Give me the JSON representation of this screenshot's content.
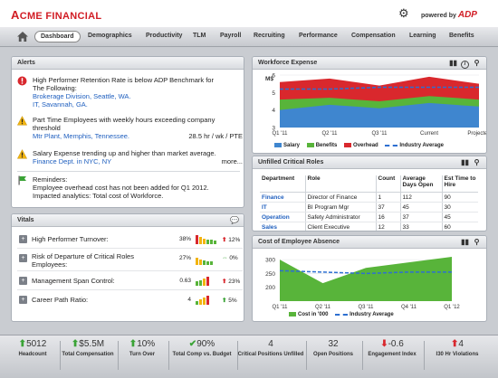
{
  "header": {
    "logo_lead": "A",
    "logo_rest": "CME FINANCIAL",
    "powered_by": "powered by",
    "powered_brand": "ADP"
  },
  "nav": {
    "tabs": [
      "Dashboard",
      "Demographics",
      "Productivity",
      "TLM",
      "Payroll",
      "Recruiting",
      "Performance",
      "Compensation",
      "Learning",
      "Benefits"
    ],
    "active": "Dashboard"
  },
  "alerts": {
    "title": "Alerts",
    "items": [
      {
        "icon": "error",
        "line1": "High Performer Retention Rate is below ADP Benchmark for",
        "line2": "The Following:",
        "link1": "Brokerage Division, Seattle, WA.",
        "link2": "IT, Savannah, GA."
      },
      {
        "icon": "warning",
        "line1": "Part Time Employees with weekly hours exceeding company",
        "line2": "threshold",
        "link1": "Mtr Plant, Memphis, Tennessee.",
        "value": "28.5 hr / wk / PTE"
      },
      {
        "icon": "warning",
        "line1": "Salary Expense trending up and higher than market average.",
        "link1": "Finance Dept. in NYC, NY",
        "more": "more..."
      },
      {
        "icon": "flag",
        "line1": "Reminders:",
        "line2": "Employee overhead cost has not been added for Q1 2012.",
        "line3": "Impacted analytics: Total cost of Workforce."
      }
    ]
  },
  "vitals": {
    "title": "Vitals",
    "rows": [
      {
        "label": "High Performer Turnover:",
        "value": "38%",
        "trend": "up",
        "change": "12%"
      },
      {
        "label": "Risk of Departure of Critical Roles Employees:",
        "value": "27%",
        "trend": "flat",
        "change": "0%"
      },
      {
        "label": "Management Span Control:",
        "value": "0.63",
        "trend": "up",
        "change": "23%"
      },
      {
        "label": "Career Path Ratio:",
        "value": "4",
        "trend": "up",
        "change": "5%"
      }
    ]
  },
  "workforce_expense": {
    "title": "Workforce Expense",
    "unit_label": "M$",
    "legend": [
      "Salary",
      "Benefits",
      "Overhead",
      "Industry Average"
    ]
  },
  "critical_roles": {
    "title": "Unfilled Critical Roles",
    "columns": [
      "Department",
      "Role",
      "Count",
      "Average Days Open",
      "Est Time to Hire"
    ],
    "rows": [
      [
        "Finance",
        "Director of Finance",
        "1",
        "112",
        "90"
      ],
      [
        "IT",
        "BI Program Mgr",
        "37",
        "45",
        "30"
      ],
      [
        "Operation",
        "Safety Administrator",
        "16",
        "37",
        "45"
      ],
      [
        "Sales",
        "Client Executive",
        "12",
        "33",
        "60"
      ]
    ]
  },
  "absence": {
    "title": "Cost of Employee Absence",
    "legend": [
      "Cost in '000",
      "Industry Average"
    ]
  },
  "metrics": [
    {
      "icon": "up",
      "value": "5012",
      "label": "Headcount"
    },
    {
      "icon": "up",
      "value": "$5.5M",
      "label": "Total Compensation"
    },
    {
      "icon": "up",
      "value": "10%",
      "label": "Turn Over"
    },
    {
      "icon": "check",
      "value": "90%",
      "label": "Total Comp vs. Budget"
    },
    {
      "icon": "none",
      "value": "4",
      "label": "Critical Positions Unfilled"
    },
    {
      "icon": "none",
      "value": "32",
      "label": "Open Positions"
    },
    {
      "icon": "down",
      "value": "-0.6",
      "label": "Engagement Index"
    },
    {
      "icon": "down",
      "value": "4",
      "label": "I30 Hr Violations"
    }
  ],
  "colors": {
    "salary": "#3f86cf",
    "benefits": "#58b43a",
    "overhead": "#d9282d",
    "industry": "#2d6fd1"
  },
  "chart_data": [
    {
      "type": "area",
      "title": "Workforce Expense",
      "ylabel": "M$",
      "x": [
        "Q1 '11",
        "Q2 '11",
        "Q3 '11",
        "Current",
        "Projected"
      ],
      "ylim": [
        3,
        6
      ],
      "yticks": [
        3,
        4,
        5,
        6
      ],
      "series": [
        {
          "name": "Salary",
          "values": [
            4.0,
            4.3,
            4.1,
            4.4,
            4.2
          ]
        },
        {
          "name": "Benefits",
          "values": [
            4.6,
            4.7,
            4.5,
            4.8,
            4.6
          ]
        },
        {
          "name": "Overhead",
          "values": [
            5.6,
            5.8,
            5.4,
            5.9,
            5.5
          ]
        },
        {
          "name": "Industry Average",
          "values": [
            5.2,
            5.2,
            5.3,
            5.3,
            5.3
          ]
        }
      ]
    },
    {
      "type": "area",
      "title": "Cost of Employee Absence",
      "x": [
        "Q1 '11",
        "Q2 '11",
        "Q3 '11",
        "Q4 '11",
        "Q1 '12"
      ],
      "ylim": [
        150,
        320
      ],
      "yticks": [
        200,
        250,
        300
      ],
      "series": [
        {
          "name": "Cost in '000",
          "values": [
            300,
            215,
            270,
            290,
            310
          ]
        },
        {
          "name": "Industry Average",
          "values": [
            260,
            255,
            250,
            255,
            255
          ]
        }
      ]
    }
  ]
}
